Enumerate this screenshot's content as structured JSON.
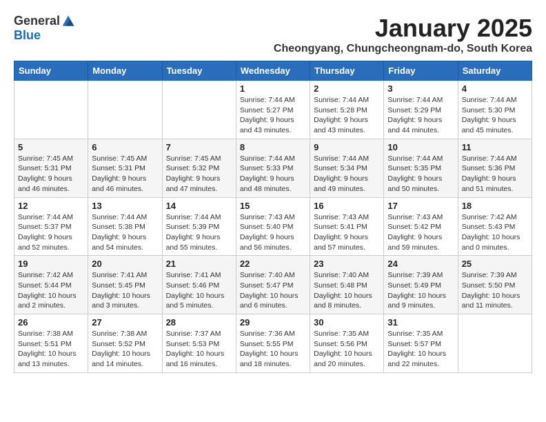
{
  "logo": {
    "general": "General",
    "blue": "Blue"
  },
  "title": "January 2025",
  "location": "Cheongyang, Chungcheongnam-do, South Korea",
  "weekdays": [
    "Sunday",
    "Monday",
    "Tuesday",
    "Wednesday",
    "Thursday",
    "Friday",
    "Saturday"
  ],
  "weeks": [
    [
      {
        "day": "",
        "info": ""
      },
      {
        "day": "",
        "info": ""
      },
      {
        "day": "",
        "info": ""
      },
      {
        "day": "1",
        "info": "Sunrise: 7:44 AM\nSunset: 5:27 PM\nDaylight: 9 hours\nand 43 minutes."
      },
      {
        "day": "2",
        "info": "Sunrise: 7:44 AM\nSunset: 5:28 PM\nDaylight: 9 hours\nand 43 minutes."
      },
      {
        "day": "3",
        "info": "Sunrise: 7:44 AM\nSunset: 5:29 PM\nDaylight: 9 hours\nand 44 minutes."
      },
      {
        "day": "4",
        "info": "Sunrise: 7:44 AM\nSunset: 5:30 PM\nDaylight: 9 hours\nand 45 minutes."
      }
    ],
    [
      {
        "day": "5",
        "info": "Sunrise: 7:45 AM\nSunset: 5:31 PM\nDaylight: 9 hours\nand 46 minutes."
      },
      {
        "day": "6",
        "info": "Sunrise: 7:45 AM\nSunset: 5:31 PM\nDaylight: 9 hours\nand 46 minutes."
      },
      {
        "day": "7",
        "info": "Sunrise: 7:45 AM\nSunset: 5:32 PM\nDaylight: 9 hours\nand 47 minutes."
      },
      {
        "day": "8",
        "info": "Sunrise: 7:44 AM\nSunset: 5:33 PM\nDaylight: 9 hours\nand 48 minutes."
      },
      {
        "day": "9",
        "info": "Sunrise: 7:44 AM\nSunset: 5:34 PM\nDaylight: 9 hours\nand 49 minutes."
      },
      {
        "day": "10",
        "info": "Sunrise: 7:44 AM\nSunset: 5:35 PM\nDaylight: 9 hours\nand 50 minutes."
      },
      {
        "day": "11",
        "info": "Sunrise: 7:44 AM\nSunset: 5:36 PM\nDaylight: 9 hours\nand 51 minutes."
      }
    ],
    [
      {
        "day": "12",
        "info": "Sunrise: 7:44 AM\nSunset: 5:37 PM\nDaylight: 9 hours\nand 52 minutes."
      },
      {
        "day": "13",
        "info": "Sunrise: 7:44 AM\nSunset: 5:38 PM\nDaylight: 9 hours\nand 54 minutes."
      },
      {
        "day": "14",
        "info": "Sunrise: 7:44 AM\nSunset: 5:39 PM\nDaylight: 9 hours\nand 55 minutes."
      },
      {
        "day": "15",
        "info": "Sunrise: 7:43 AM\nSunset: 5:40 PM\nDaylight: 9 hours\nand 56 minutes."
      },
      {
        "day": "16",
        "info": "Sunrise: 7:43 AM\nSunset: 5:41 PM\nDaylight: 9 hours\nand 57 minutes."
      },
      {
        "day": "17",
        "info": "Sunrise: 7:43 AM\nSunset: 5:42 PM\nDaylight: 9 hours\nand 59 minutes."
      },
      {
        "day": "18",
        "info": "Sunrise: 7:42 AM\nSunset: 5:43 PM\nDaylight: 10 hours\nand 0 minutes."
      }
    ],
    [
      {
        "day": "19",
        "info": "Sunrise: 7:42 AM\nSunset: 5:44 PM\nDaylight: 10 hours\nand 2 minutes."
      },
      {
        "day": "20",
        "info": "Sunrise: 7:41 AM\nSunset: 5:45 PM\nDaylight: 10 hours\nand 3 minutes."
      },
      {
        "day": "21",
        "info": "Sunrise: 7:41 AM\nSunset: 5:46 PM\nDaylight: 10 hours\nand 5 minutes."
      },
      {
        "day": "22",
        "info": "Sunrise: 7:40 AM\nSunset: 5:47 PM\nDaylight: 10 hours\nand 6 minutes."
      },
      {
        "day": "23",
        "info": "Sunrise: 7:40 AM\nSunset: 5:48 PM\nDaylight: 10 hours\nand 8 minutes."
      },
      {
        "day": "24",
        "info": "Sunrise: 7:39 AM\nSunset: 5:49 PM\nDaylight: 10 hours\nand 9 minutes."
      },
      {
        "day": "25",
        "info": "Sunrise: 7:39 AM\nSunset: 5:50 PM\nDaylight: 10 hours\nand 11 minutes."
      }
    ],
    [
      {
        "day": "26",
        "info": "Sunrise: 7:38 AM\nSunset: 5:51 PM\nDaylight: 10 hours\nand 13 minutes."
      },
      {
        "day": "27",
        "info": "Sunrise: 7:38 AM\nSunset: 5:52 PM\nDaylight: 10 hours\nand 14 minutes."
      },
      {
        "day": "28",
        "info": "Sunrise: 7:37 AM\nSunset: 5:53 PM\nDaylight: 10 hours\nand 16 minutes."
      },
      {
        "day": "29",
        "info": "Sunrise: 7:36 AM\nSunset: 5:55 PM\nDaylight: 10 hours\nand 18 minutes."
      },
      {
        "day": "30",
        "info": "Sunrise: 7:35 AM\nSunset: 5:56 PM\nDaylight: 10 hours\nand 20 minutes."
      },
      {
        "day": "31",
        "info": "Sunrise: 7:35 AM\nSunset: 5:57 PM\nDaylight: 10 hours\nand 22 minutes."
      },
      {
        "day": "",
        "info": ""
      }
    ]
  ]
}
